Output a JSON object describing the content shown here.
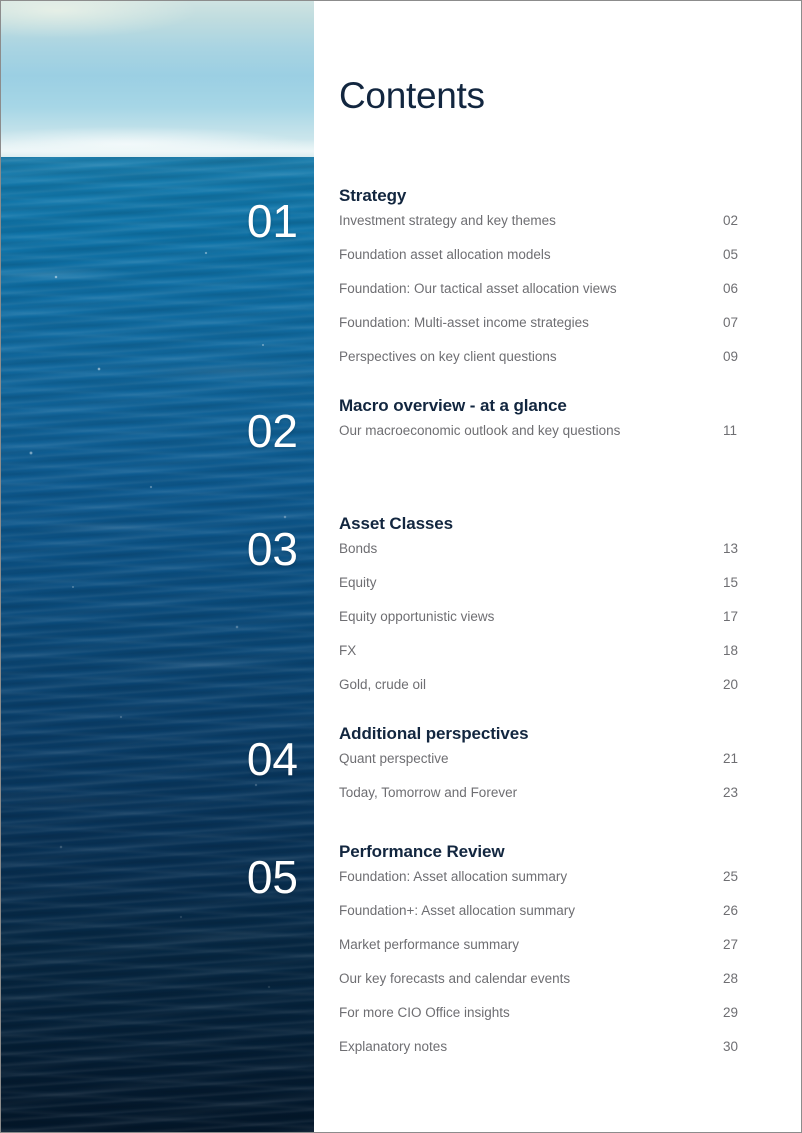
{
  "document": {
    "title": "Contents"
  },
  "cover_image": {
    "name": "ocean-horizon-photo",
    "description": "Open ocean with horizon and sky",
    "colors": {
      "sky_top": "#cfe3e2",
      "sky_bottom": "#d8ecef",
      "sea_top": "#1c7fae",
      "sea_bottom": "#03172a"
    }
  },
  "sections": [
    {
      "number": "01",
      "heading": "Strategy",
      "entries": [
        {
          "title": "Investment strategy and key themes",
          "page": "02"
        },
        {
          "title": "Foundation asset allocation models",
          "page": "05"
        },
        {
          "title": "Foundation: Our tactical asset allocation views",
          "page": "06"
        },
        {
          "title": "Foundation: Multi-asset income strategies",
          "page": "07"
        },
        {
          "title": "Perspectives on key client questions",
          "page": "09"
        }
      ]
    },
    {
      "number": "02",
      "heading": "Macro overview - at a glance",
      "entries": [
        {
          "title": "Our macroeconomic outlook and key questions",
          "page": "11"
        }
      ]
    },
    {
      "number": "03",
      "heading": "Asset Classes",
      "entries": [
        {
          "title": "Bonds",
          "page": "13"
        },
        {
          "title": "Equity",
          "page": "15"
        },
        {
          "title": "Equity opportunistic views",
          "page": "17"
        },
        {
          "title": "FX",
          "page": "18"
        },
        {
          "title": "Gold, crude oil",
          "page": "20"
        }
      ]
    },
    {
      "number": "04",
      "heading": "Additional perspectives",
      "entries": [
        {
          "title": "Quant perspective",
          "page": "21"
        },
        {
          "title": "Today, Tomorrow and Forever",
          "page": "23"
        }
      ]
    },
    {
      "number": "05",
      "heading": "Performance Review",
      "entries": [
        {
          "title": "Foundation: Asset allocation summary",
          "page": "25"
        },
        {
          "title": "Foundation+: Asset allocation summary",
          "page": "26"
        },
        {
          "title": "Market performance summary",
          "page": "27"
        },
        {
          "title": "Our key forecasts and calendar events",
          "page": "28"
        },
        {
          "title": "For more CIO Office insights",
          "page": "29"
        },
        {
          "title": "Explanatory notes",
          "page": "30"
        }
      ]
    }
  ],
  "layout": {
    "section_tops": [
      186,
      396,
      514,
      724,
      842
    ],
    "number_tops": [
      197,
      407,
      525,
      735,
      853
    ]
  }
}
